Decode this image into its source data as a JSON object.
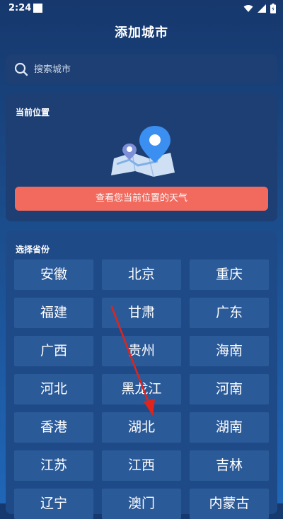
{
  "status_bar": {
    "time": "2:24"
  },
  "header": {
    "title": "添加城市"
  },
  "search": {
    "placeholder": "搜索城市"
  },
  "current_location": {
    "heading": "当前位置",
    "button_label": "查看您当前位置的天气"
  },
  "province_section": {
    "heading": "选择省份",
    "provinces": [
      "安徽",
      "北京",
      "重庆",
      "福建",
      "甘肃",
      "广东",
      "广西",
      "贵州",
      "海南",
      "河北",
      "黑龙江",
      "河南",
      "香港",
      "湖北",
      "湖南",
      "江苏",
      "江西",
      "吉林",
      "辽宁",
      "澳门",
      "内蒙古"
    ]
  },
  "colors": {
    "accent_button": "#f26a5e",
    "card_background": "#1e3f73",
    "province_button": "#2b5a99",
    "annotation_arrow": "#e0241c"
  }
}
